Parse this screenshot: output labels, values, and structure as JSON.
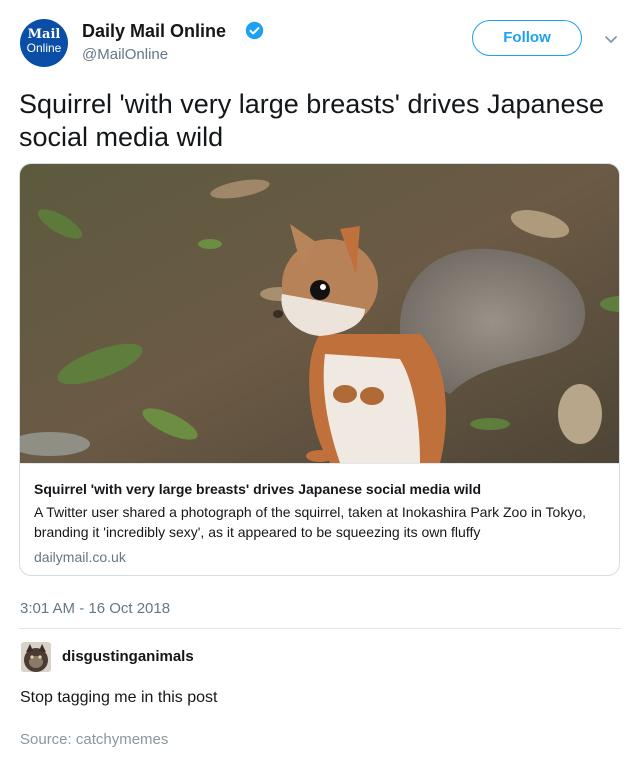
{
  "header": {
    "avatar_line1": "Mail",
    "avatar_line2": "Online",
    "display_name": "Daily Mail Online",
    "handle": "@MailOnline",
    "follow_label": "Follow"
  },
  "tweet": {
    "text": "Squirrel 'with very large breasts' drives Japanese social media wild",
    "timestamp": "3:01 AM - 16 Oct 2018"
  },
  "card": {
    "title": "Squirrel 'with very large breasts' drives Japanese social media wild",
    "description": "A Twitter user shared a photograph of the squirrel, taken at Inokashira Park Zoo in Tokyo, branding it 'incredibly sexy', as it appeared to be squeezing its own fluffy",
    "domain": "dailymail.co.uk"
  },
  "reply": {
    "username": "disgustinganimals",
    "text": "Stop tagging me in this post"
  },
  "footer": {
    "source": "Source:  catchymemes"
  },
  "colors": {
    "accent": "#1da1f2",
    "avatar_bg": "#0a4ea8",
    "muted": "#657786"
  },
  "icons": {
    "verified": "verified-badge-icon",
    "menu": "chevron-down-icon"
  }
}
